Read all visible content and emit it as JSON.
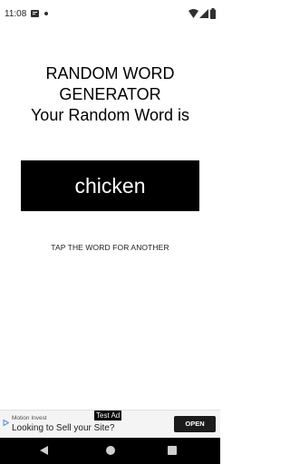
{
  "status_bar": {
    "time": "11:08",
    "icons": [
      "message-icon",
      "dot-icon",
      "wifi-icon",
      "signal-icon",
      "battery-icon"
    ]
  },
  "title": {
    "line1": "RANDOM WORD",
    "line2": "GENERATOR",
    "line3": "Your Random Word is"
  },
  "word": "chicken",
  "hint": "TAP THE WORD FOR ANOTHER",
  "ad": {
    "label": "Test Ad",
    "advertiser": "Motion Invest",
    "headline": "Looking to Sell your Site?",
    "cta": "OPEN"
  },
  "nav_bar": {
    "icons": [
      "back-icon",
      "home-icon",
      "recents-icon"
    ]
  },
  "colors": {
    "background": "#ffffff",
    "word_button": "#000000",
    "word_text": "#ffffff",
    "nav_bar": "#000000"
  }
}
